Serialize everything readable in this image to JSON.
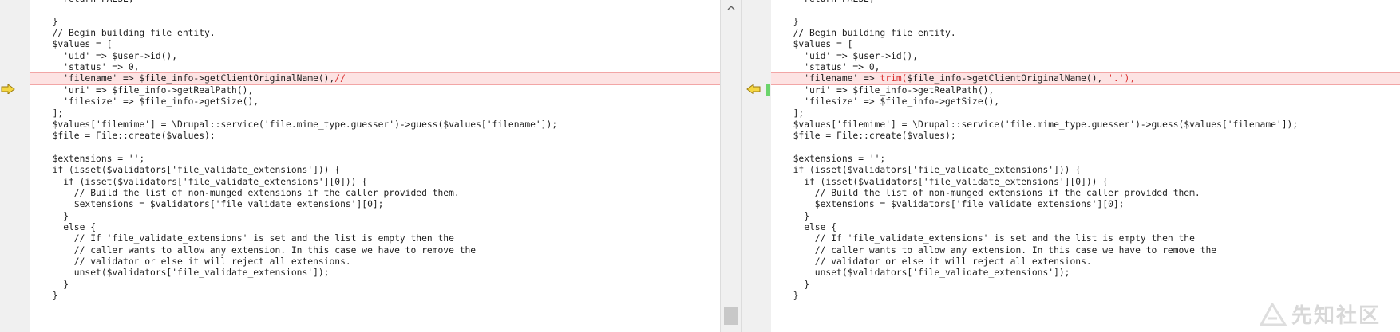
{
  "left": {
    "lines": [
      "    return FALSE;",
      "",
      "  }",
      "  // Begin building file entity.",
      "  $values = [",
      "    'uid' => $user->id(),",
      "    'status' => 0,",
      "    'filename' => $file_info->getClientOriginalName(),",
      "    'uri' => $file_info->getRealPath(),",
      "    'filesize' => $file_info->getSize(),",
      "  ];",
      "  $values['filemime'] = \\Drupal::service('file.mime_type.guesser')->guess($values['filename']);",
      "  $file = File::create($values);",
      "",
      "  $extensions = '';",
      "  if (isset($validators['file_validate_extensions'])) {",
      "    if (isset($validators['file_validate_extensions'][0])) {",
      "      // Build the list of non-munged extensions if the caller provided them.",
      "      $extensions = $validators['file_validate_extensions'][0];",
      "    }",
      "    else {",
      "      // If 'file_validate_extensions' is set and the list is empty then the",
      "      // caller wants to allow any extension. In this case we have to remove the",
      "      // validator or else it will reject all extensions.",
      "      unset($validators['file_validate_extensions']);",
      "    }",
      "  }"
    ],
    "changed_suffix": "//"
  },
  "right": {
    "lines": [
      "    return FALSE;",
      "",
      "  }",
      "  // Begin building file entity.",
      "  $values = [",
      "    'uid' => $user->id(),",
      "    'status' => 0,",
      "    'filename' => trim($file_info->getClientOriginalName(), '.'),",
      "    'uri' => $file_info->getRealPath(),",
      "    'filesize' => $file_info->getSize(),",
      "  ];",
      "  $values['filemime'] = \\Drupal::service('file.mime_type.guesser')->guess($values['filename']);",
      "  $file = File::create($values);",
      "",
      "  $extensions = '';",
      "  if (isset($validators['file_validate_extensions'])) {",
      "    if (isset($validators['file_validate_extensions'][0])) {",
      "      // Build the list of non-munged extensions if the caller provided them.",
      "      $extensions = $validators['file_validate_extensions'][0];",
      "    }",
      "    else {",
      "      // If 'file_validate_extensions' is set and the list is empty then the",
      "      // caller wants to allow any extension. In this case we have to remove the",
      "      // validator or else it will reject all extensions.",
      "      unset($validators['file_validate_extensions']);",
      "    }",
      "  }"
    ],
    "changed_prefix": "    'filename' => ",
    "changed_trim": "trim(",
    "changed_middle": "$file_info->getClientOriginalName(), ",
    "changed_tail": "'.'),"
  },
  "changed_line_index": 7,
  "icons": {
    "left_arrow": "arrow-right-icon",
    "right_arrow": "arrow-left-icon",
    "scroll_up": "chevron-up-icon"
  },
  "watermark_text": "先知社区",
  "colors": {
    "changed_bg": "#fde3e3",
    "changed_text": "#d83030",
    "arrow_fill": "#f5d742",
    "change_marker": "#6bd46b"
  }
}
